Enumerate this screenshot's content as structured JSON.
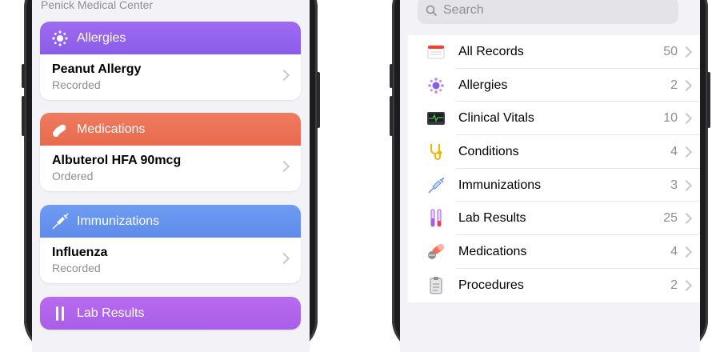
{
  "left_phone": {
    "provider": "Penick Medical Center",
    "cards": [
      {
        "title": "Allergies",
        "item": "Peanut Allergy",
        "status": "Recorded",
        "color_top": "#9f6bf0",
        "color_bottom": "#8a5ce8",
        "icon": "allergies-icon"
      },
      {
        "title": "Medications",
        "item": "Albuterol HFA 90mcg",
        "status": "Ordered",
        "color_top": "#ef7b5e",
        "color_bottom": "#e86a4f",
        "icon": "medications-icon"
      },
      {
        "title": "Immunizations",
        "item": "Influenza",
        "status": "Recorded",
        "color_top": "#6f9bf2",
        "color_bottom": "#5e8ce9",
        "icon": "immunizations-icon"
      },
      {
        "title": "Lab Results",
        "color_top": "#b86bf0",
        "color_bottom": "#a95ee6",
        "icon": "lab-results-icon"
      }
    ]
  },
  "right_phone": {
    "search": {
      "placeholder": "Search"
    },
    "records": [
      {
        "label": "All Records",
        "count": "50",
        "icon": "all-records-icon"
      },
      {
        "label": "Allergies",
        "count": "2",
        "icon": "allergies-icon"
      },
      {
        "label": "Clinical Vitals",
        "count": "10",
        "icon": "clinical-vitals-icon"
      },
      {
        "label": "Conditions",
        "count": "4",
        "icon": "conditions-icon"
      },
      {
        "label": "Immunizations",
        "count": "3",
        "icon": "immunizations-icon"
      },
      {
        "label": "Lab Results",
        "count": "25",
        "icon": "lab-results-icon"
      },
      {
        "label": "Medications",
        "count": "4",
        "icon": "medications-icon"
      },
      {
        "label": "Procedures",
        "count": "2",
        "icon": "procedures-icon"
      }
    ]
  }
}
